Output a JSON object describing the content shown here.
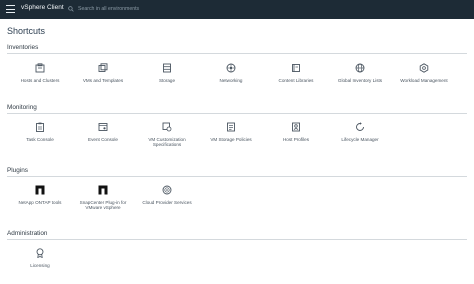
{
  "header": {
    "app_title": "vSphere Client",
    "search_placeholder": "Search in all environments"
  },
  "page": {
    "title": "Shortcuts"
  },
  "sections": {
    "inventories": {
      "title": "Inventories",
      "items": [
        {
          "label": "Hosts and Clusters",
          "icon": "hosts-clusters-icon"
        },
        {
          "label": "VMs and Templates",
          "icon": "vms-templates-icon"
        },
        {
          "label": "Storage",
          "icon": "storage-icon"
        },
        {
          "label": "Networking",
          "icon": "networking-icon"
        },
        {
          "label": "Content Libraries",
          "icon": "content-libraries-icon"
        },
        {
          "label": "Global Inventory Lists",
          "icon": "global-inventory-icon"
        },
        {
          "label": "Workload Management",
          "icon": "workload-management-icon"
        }
      ]
    },
    "monitoring": {
      "title": "Monitoring",
      "items": [
        {
          "label": "Task Console",
          "icon": "task-console-icon"
        },
        {
          "label": "Event Console",
          "icon": "event-console-icon"
        },
        {
          "label": "VM Customization Specifications",
          "icon": "vm-customization-icon"
        },
        {
          "label": "VM Storage Policies",
          "icon": "vm-storage-policies-icon"
        },
        {
          "label": "Host Profiles",
          "icon": "host-profiles-icon"
        },
        {
          "label": "Lifecycle Manager",
          "icon": "lifecycle-manager-icon"
        }
      ]
    },
    "plugins": {
      "title": "Plugins",
      "items": [
        {
          "label": "NetApp ONTAP tools",
          "icon": "netapp-icon"
        },
        {
          "label": "SnapCenter Plug-in for VMware vSphere",
          "icon": "netapp-icon"
        },
        {
          "label": "Cloud Provider Services",
          "icon": "cloud-provider-icon"
        }
      ]
    },
    "administration": {
      "title": "Administration",
      "items": [
        {
          "label": "Licensing",
          "icon": "licensing-icon"
        }
      ]
    }
  },
  "colors": {
    "header_bg": "#1d2b36",
    "icon_stroke": "#4a5560",
    "divider": "#d4d9dd"
  }
}
